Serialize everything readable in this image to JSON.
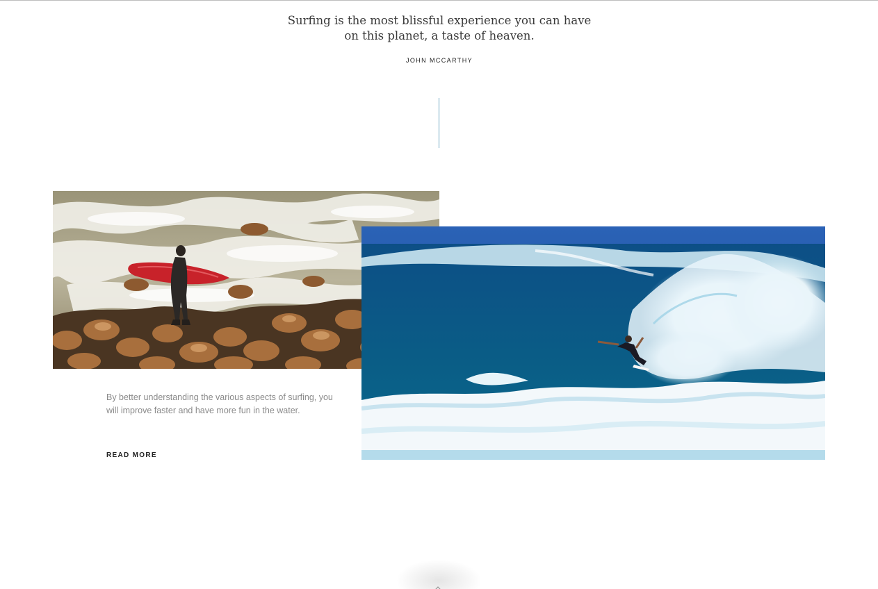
{
  "quote": {
    "line1": "Surfing is the most blissful experience you can have",
    "line2": "on this planet, a taste of heaven.",
    "author": "JOHN MCCARTHY"
  },
  "post": {
    "excerpt": "By better understanding the various aspects of surfing, you will improve faster and have more fun in the water.",
    "read_more_label": "READ MORE"
  },
  "colors": {
    "divider": "#6ea7c4",
    "quote_text": "#3a3a3a",
    "excerpt_text": "#8a8a8a"
  },
  "icons": {
    "scroll_top": "chevron-up-icon"
  }
}
